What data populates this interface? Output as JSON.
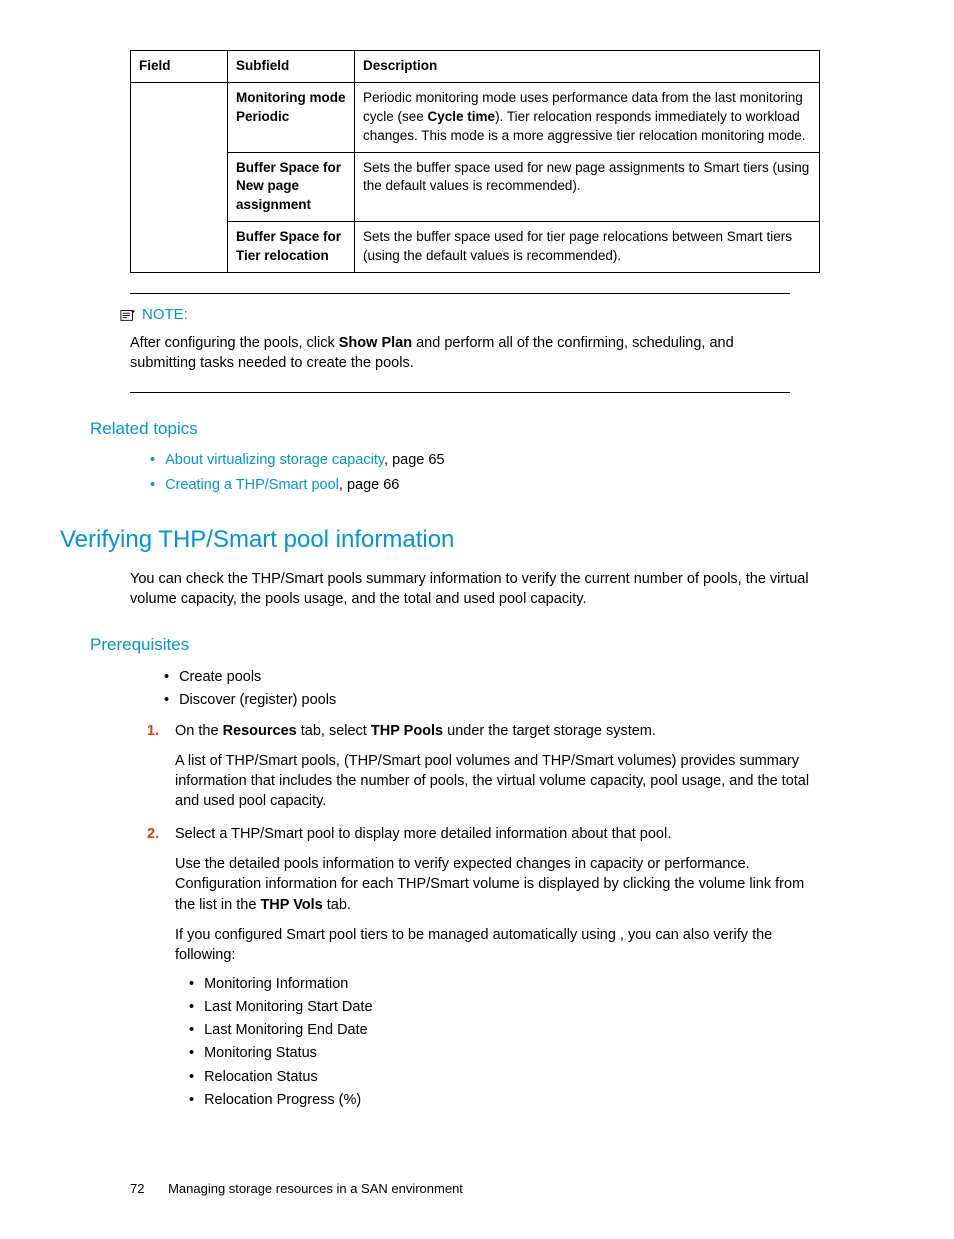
{
  "table": {
    "headers": {
      "field": "Field",
      "subfield": "Subfield",
      "description": "Description"
    },
    "rows": [
      {
        "sub1": "Monitoring mode",
        "sub2": "Periodic",
        "desc_a": "Periodic monitoring mode uses performance data from the last monitoring cycle (see ",
        "desc_b": "Cycle time",
        "desc_c": "). Tier relocation responds immediately to workload changes. This mode is a more aggressive tier relocation monitoring mode."
      },
      {
        "sub1": "Buffer Space for New page assignment",
        "desc": "Sets the buffer space used for new page assignments to Smart tiers (using the default values is recommended)."
      },
      {
        "sub1": "Buffer Space for Tier relocation",
        "desc": "Sets the buffer space used for tier page relocations between Smart tiers (using the default values is recommended)."
      }
    ]
  },
  "note": {
    "label": "NOTE:",
    "body_a": "After configuring the pools, click ",
    "body_b": "Show Plan",
    "body_c": " and perform all of the confirming, scheduling, and submitting tasks needed to create the pools."
  },
  "related": {
    "heading": "Related topics",
    "items": [
      {
        "link": "About virtualizing storage capacity",
        "suffix": ", page 65"
      },
      {
        "link": "Creating a THP/Smart pool",
        "suffix": ", page 66"
      }
    ]
  },
  "main": {
    "heading": "Verifying THP/Smart pool information",
    "intro": "You can check the THP/Smart pools summary information to verify the current number of pools, the virtual volume capacity, the pools usage, and the total and used pool capacity."
  },
  "prereq": {
    "heading": "Prerequisites",
    "bullets": [
      "Create pools",
      "Discover (register) pools"
    ],
    "steps": {
      "s1_a": "On the ",
      "s1_b": "Resources",
      "s1_c": " tab, select ",
      "s1_d": "THP Pools",
      "s1_e": " under the target storage system.",
      "s1_p": "A list of THP/Smart pools, (THP/Smart pool volumes and THP/Smart volumes) provides summary information that includes the number of pools, the virtual volume capacity, pool usage, and the total and used pool capacity.",
      "s2": "Select a THP/Smart pool to display more detailed information about that pool.",
      "s2_p1_a": "Use the detailed pools information to verify expected changes in capacity or performance. Configuration information for each THP/Smart volume is displayed by clicking the volume link from the list in the ",
      "s2_p1_b": "THP Vols",
      "s2_p1_c": " tab.",
      "s2_p2": "If you configured Smart pool tiers to be managed automatically using , you can also verify the following:",
      "s2_list": [
        "Monitoring Information",
        "Last Monitoring Start Date",
        "Last Monitoring End Date",
        "Monitoring Status",
        "Relocation Status",
        "Relocation Progress (%)"
      ]
    }
  },
  "footer": {
    "page": "72",
    "title": "Managing storage resources in a SAN environment"
  }
}
